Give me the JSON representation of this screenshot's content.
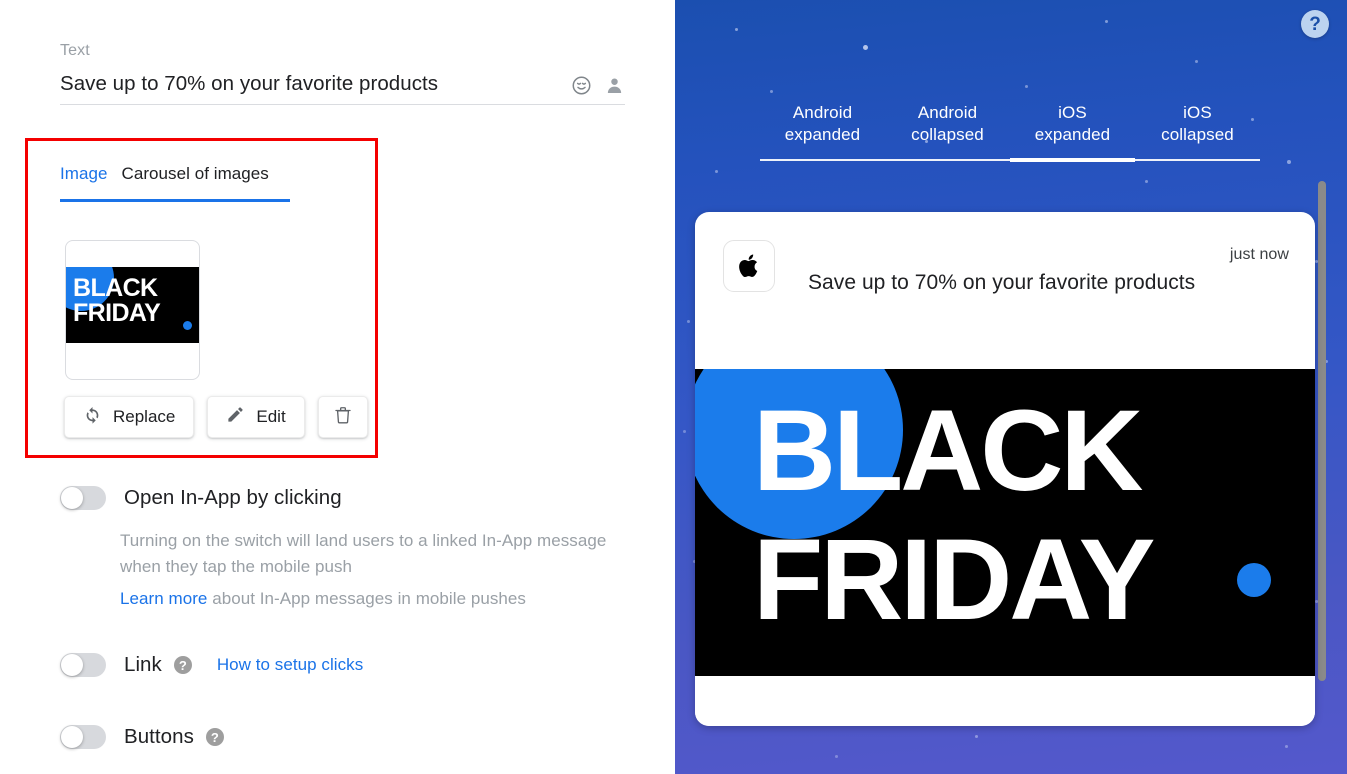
{
  "editor": {
    "text_field": {
      "label": "Text",
      "value": "Save up to 70% on your favorite products",
      "emoji_icon": "emoji-smiley-icon",
      "personalize_icon": "person-icon"
    },
    "image_tabs": [
      {
        "label": "Image",
        "active": true
      },
      {
        "label": "Carousel of images",
        "active": false
      }
    ],
    "thumbnail": {
      "line1": "BLACK",
      "line2": "FRIDAY"
    },
    "actions": [
      {
        "label": "Replace",
        "icon": "refresh-icon"
      },
      {
        "label": "Edit",
        "icon": "pencil-icon"
      },
      {
        "label": "",
        "icon": "trash-icon"
      }
    ],
    "open_in_app": {
      "label": "Open In-App by clicking",
      "enabled": false,
      "description": "Turning on the switch will land users to a linked In-App message when they tap the mobile push",
      "learn_more_label": "Learn more",
      "learn_more_suffix": " about In-App messages in mobile pushes"
    },
    "link": {
      "label": "Link",
      "enabled": false,
      "help_icon": "question-mark-icon",
      "link_label": "How to setup clicks"
    },
    "buttons": {
      "label": "Buttons",
      "enabled": false,
      "help_icon": "question-mark-icon"
    },
    "highlight_color": "#f40000"
  },
  "preview": {
    "help_button": {
      "icon": "question-mark-icon",
      "label": "?"
    },
    "tabs": [
      {
        "line1": "Android",
        "line2": "expanded",
        "active": false
      },
      {
        "line1": "Android",
        "line2": "collapsed",
        "active": false
      },
      {
        "line1": "iOS",
        "line2": "expanded",
        "active": true
      },
      {
        "line1": "iOS",
        "line2": "collapsed",
        "active": false
      }
    ],
    "notification": {
      "app_icon": "apple-logo-icon",
      "time": "just now",
      "title": "Save up to 70% on your favorite products",
      "image": {
        "line1": "BLACK",
        "line2": "FRIDAY"
      }
    },
    "accent_color": "#1a73e8",
    "background_top": "#1b4fb0",
    "background_bottom": "#5458cc"
  }
}
